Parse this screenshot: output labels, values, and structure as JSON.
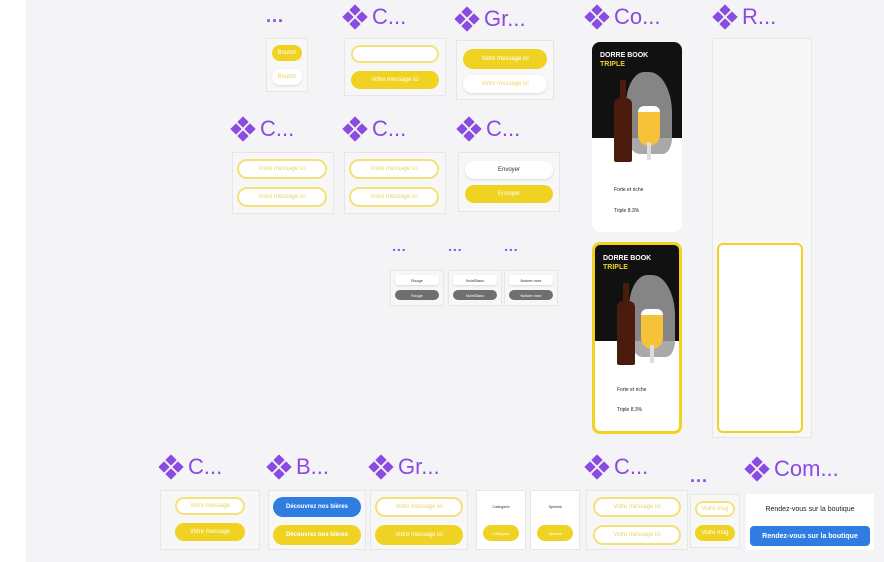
{
  "frame_labels": {
    "top_row": [
      "...",
      "C...",
      "Gr...",
      "Co...",
      "R..."
    ],
    "mid_row": [
      "C...",
      "C...",
      "C..."
    ],
    "dots_row": [
      "...",
      "...",
      "..."
    ],
    "bottom_row": [
      "C...",
      "B...",
      "Gr...",
      "C...",
      "...",
      "Com..."
    ]
  },
  "buttons": {
    "b1": "Bouton",
    "b2": "Bouton",
    "c1_a": "",
    "c1_b": "Votre message ici",
    "gr1_a": "Votre message ici",
    "gr1_b": "Votre message ici",
    "c2_a": "Votre message ici",
    "c2_b": "Votre message ici",
    "c3_a": "Votre message ici",
    "c3_b": "Votre message ici",
    "c4_a": "Envoyer",
    "c4_b": "Envoyer",
    "small1_a": "Rouge",
    "small1_b": "Rouge",
    "small2_a": "Noir/Blanc",
    "small2_b": "Noir/Blanc",
    "small3_a": "Nature rose",
    "small3_b": "Nature rose",
    "bc1_a": "Votre message",
    "bc1_b": "Votre message",
    "bb_a": "Découvrez nos bières",
    "bb_b": "Découvrez nos bières",
    "gr2_a": "Votre message ici",
    "gr2_b": "Votre message ici",
    "mini1_a": "Catégorie",
    "mini1_b": "Catégorie",
    "mini2_a": "Spécial",
    "mini2_b": "Spécial",
    "c5_a": "Votre message ici",
    "c5_b": "Votre message ici",
    "c6_a": "Votre msg",
    "c6_b": "Votre msg",
    "com_a": "Rendez-vous sur la boutique",
    "com_b": "Rendez-vous sur la boutique"
  },
  "cards": [
    {
      "title1": "DORRE BOOK",
      "title2": "TRIPLE",
      "desc1": "Forte et riche",
      "desc2": "Triple   8.3%"
    },
    {
      "title1": "DORRE BOOK",
      "title2": "TRIPLE",
      "desc1": "Forte et riche",
      "desc2": "Triple   8.3%"
    }
  ],
  "colors": {
    "accent": "#8b4ae0",
    "yellow": "#f0d322",
    "blue": "#2f7de1",
    "grey": "#6f6f6f"
  }
}
